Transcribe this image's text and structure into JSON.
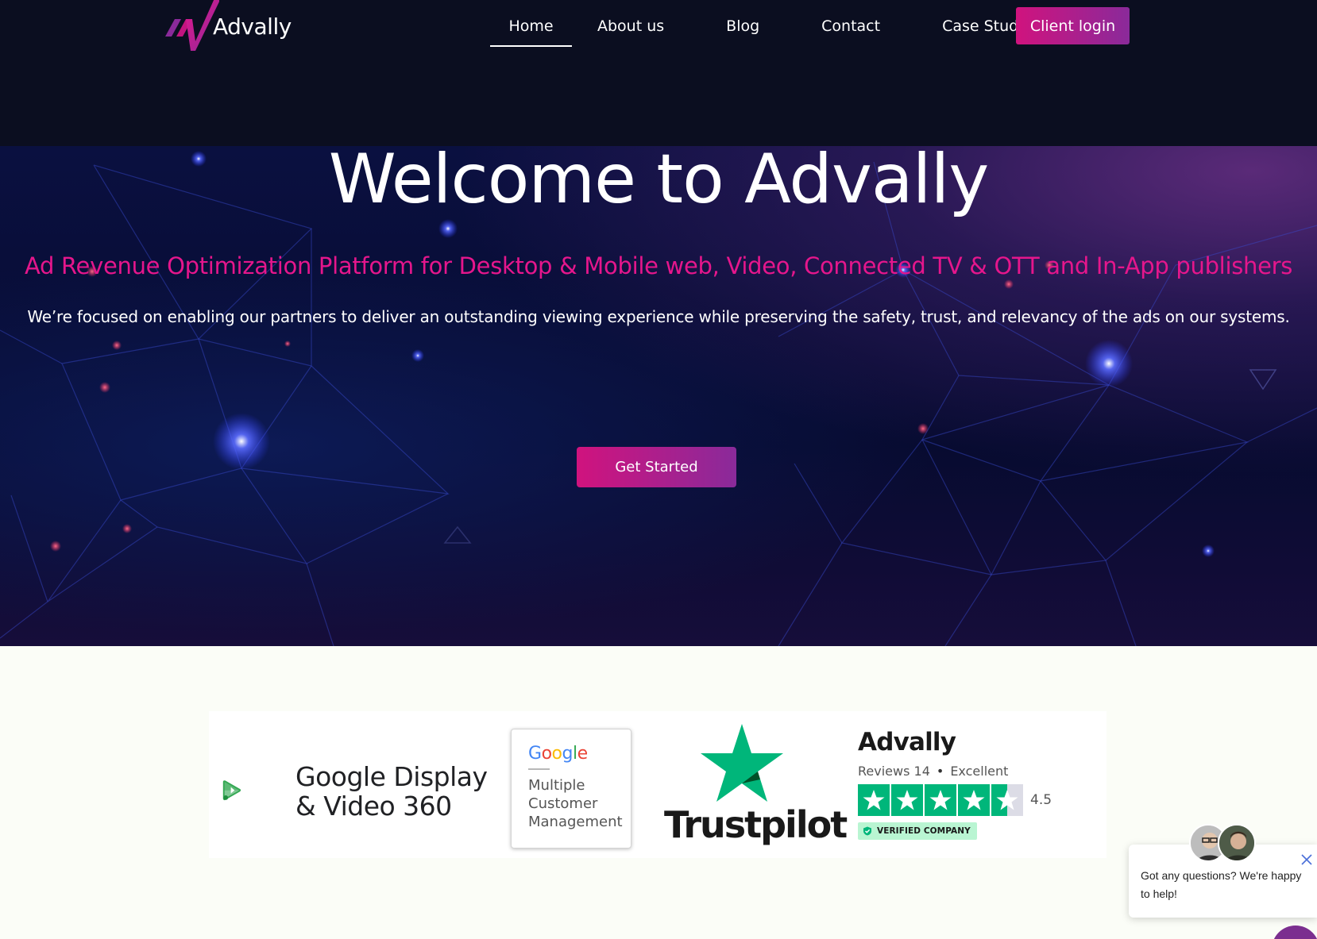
{
  "header": {
    "logo_text": "Advally",
    "nav": [
      {
        "label": "Home",
        "active": true
      },
      {
        "label": "About us"
      },
      {
        "label": "Blog"
      },
      {
        "label": "Contact"
      },
      {
        "label": "Case Studies"
      }
    ],
    "login_label": "Client login"
  },
  "hero": {
    "title": "Welcome to Advally",
    "subtitle": "Ad Revenue Optimization Platform for Desktop & Mobile web, Video, Connected TV & OTT and In-App publishers",
    "description": "We’re focused on enabling our partners to deliver an outstanding viewing experience while preserving the safety, trust, and relevancy of the ads on our systems.",
    "cta_label": "Get Started"
  },
  "partners": {
    "dv360": "Google Display\n& Video 360",
    "mcm_google": "Google",
    "mcm_text": "Multiple\nCustomer\nManagement",
    "trustpilot_wordmark": "Trustpilot",
    "trustpilot_widget": {
      "company": "Advally",
      "reviews_label": "Reviews 14",
      "rating_word": "Excellent",
      "rating_value": "4.5",
      "stars": 4.5,
      "verified_label": "VERIFIED COMPANY"
    }
  },
  "chat": {
    "message": "Got any questions? We're happy to help!"
  },
  "colors": {
    "brand_pink": "#e5168c",
    "brand_purple": "#8a2a9a",
    "trustpilot_green": "#00b67a",
    "header_bg": "#0b0e20"
  }
}
